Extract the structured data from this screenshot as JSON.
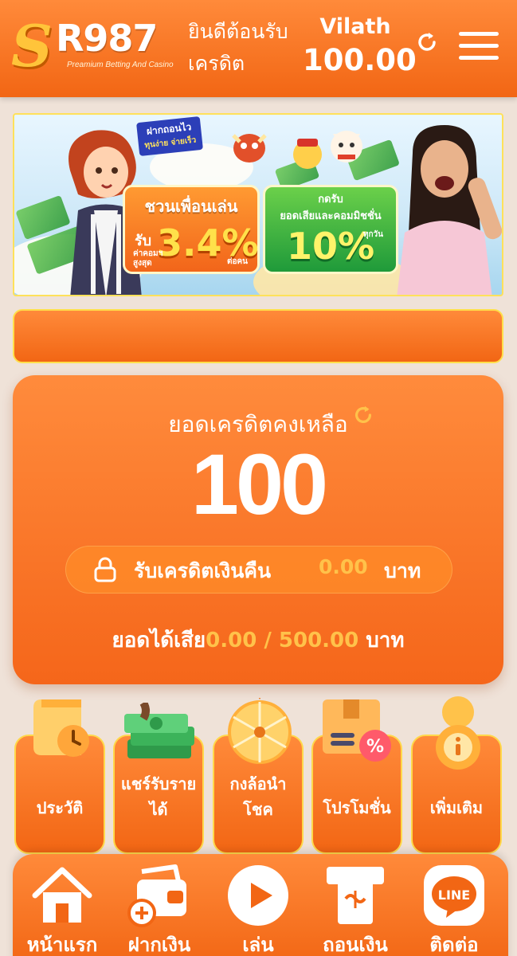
{
  "header": {
    "logo_letter": "S",
    "logo_number": "R987",
    "logo_tagline": "Preamium Betting And Casino",
    "welcome_line1": "ยินดีต้อนรับ",
    "welcome_line2": "เครดิต",
    "username": "Vilath",
    "credit": "100.00",
    "icons": {
      "refresh": "refresh-icon",
      "menu": "hamburger-menu-icon"
    }
  },
  "banner": {
    "badge_line1": "ฝากถอนไว",
    "badge_line2": "ทุนง่าย จ่ายเร็ว",
    "promo_a": {
      "title": "ชวนเพื่อนเล่น",
      "prefix": "รับ",
      "note": "ค่าคอมฯ สูงสุด",
      "percent": "3.4%",
      "suffix": "ต่อคน"
    },
    "promo_b": {
      "title_line1": "กดรับ",
      "title_line2": "ยอดเสียและคอมมิชชั่น",
      "percent": "10%",
      "note": "ทุกวัน"
    }
  },
  "marquee": {
    "text": ""
  },
  "balance": {
    "title": "ยอดเครดิตคงเหลือ",
    "value": "100",
    "cashback_label": "รับเครดิตเงินคืน",
    "cashback_amount": "0.00",
    "cashback_unit": "บาท",
    "turnover_label": "ยอดได้เสีย",
    "turnover_value": "0.00 / 500.00",
    "turnover_unit": "บาท"
  },
  "quick_menu": [
    {
      "label_line1": "ประวัติ",
      "label_line2": "",
      "icon": "history-receipt-icon"
    },
    {
      "label_line1": "แชร์รับราย",
      "label_line2": "ได้",
      "icon": "money-stack-icon"
    },
    {
      "label_line1": "กงล้อนำ",
      "label_line2": "โชค",
      "icon": "lucky-wheel-icon"
    },
    {
      "label_line1": "โปรโมชั่น",
      "label_line2": "",
      "icon": "promotion-box-icon"
    },
    {
      "label_line1": "เพิ่มเติม",
      "label_line2": "",
      "icon": "info-more-icon"
    }
  ],
  "bottom_nav": [
    {
      "label": "หน้าแรก",
      "icon": "home-icon"
    },
    {
      "label": "ฝากเงิน",
      "icon": "deposit-wallet-icon"
    },
    {
      "label": "เล่น",
      "icon": "play-icon"
    },
    {
      "label": "ถอนเงิน",
      "icon": "withdraw-atm-icon"
    },
    {
      "label": "ติดต่อ",
      "icon": "line-chat-icon"
    }
  ],
  "colors": {
    "primary": "#f26614",
    "primary_light": "#ff8a3a",
    "accent_gold": "#ffc24a",
    "background": "#efe2d8",
    "border_yellow": "#ffd84a"
  }
}
